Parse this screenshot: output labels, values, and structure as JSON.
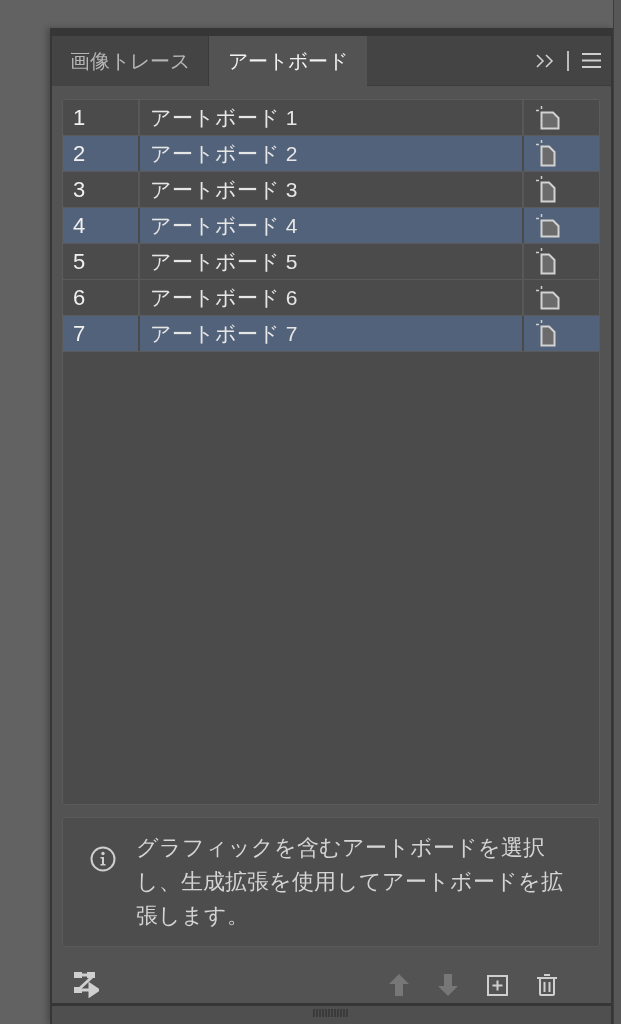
{
  "tabs": [
    {
      "label": "画像トレース",
      "selected": false
    },
    {
      "label": "アートボード",
      "selected": true
    }
  ],
  "artboards": [
    {
      "number": "1",
      "name": "アートボード 1",
      "kind": "landscape",
      "selected": false
    },
    {
      "number": "2",
      "name": "アートボード 2",
      "kind": "portrait",
      "selected": true
    },
    {
      "number": "3",
      "name": "アートボード 3",
      "kind": "portrait",
      "selected": false
    },
    {
      "number": "4",
      "name": "アートボード 4",
      "kind": "landscape",
      "selected": true
    },
    {
      "number": "5",
      "name": "アートボード 5",
      "kind": "portrait",
      "selected": false
    },
    {
      "number": "6",
      "name": "アートボード 6",
      "kind": "landscape",
      "selected": false
    },
    {
      "number": "7",
      "name": "アートボード 7",
      "kind": "portrait",
      "selected": true
    }
  ],
  "info": {
    "text": "グラフィックを含むアートボードを選択し、生成拡張を使用してアートボードを拡張します。"
  },
  "toolbar": {
    "left": [
      {
        "kind": "rearrange",
        "disabled": false
      }
    ],
    "right": [
      {
        "kind": "move_up",
        "disabled": true
      },
      {
        "kind": "move_down",
        "disabled": true
      },
      {
        "kind": "new",
        "disabled": false
      },
      {
        "kind": "delete",
        "disabled": false
      }
    ]
  }
}
